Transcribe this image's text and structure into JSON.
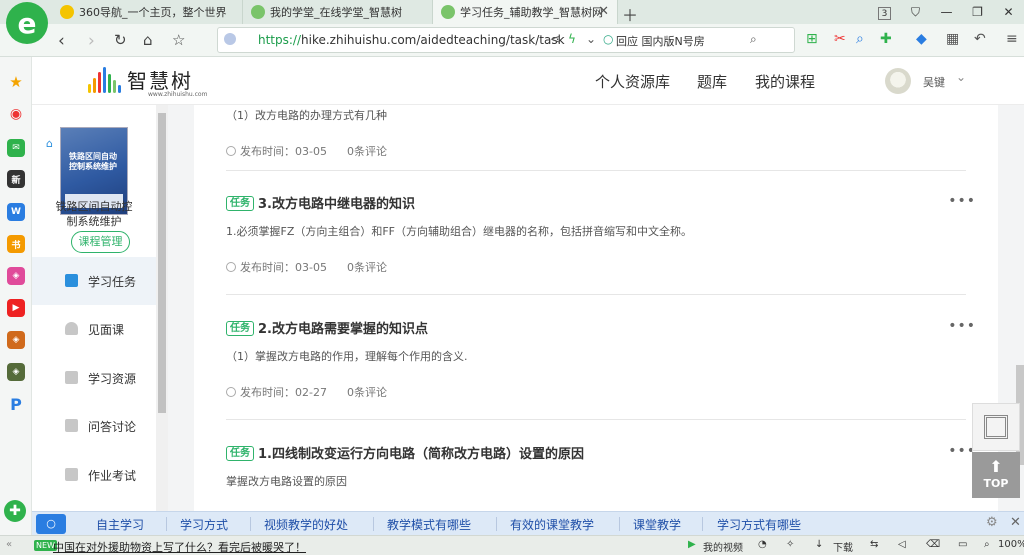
{
  "browser": {
    "tabs": [
      {
        "title": "360导航_一个主页，整个世界",
        "icon": "360-icon"
      },
      {
        "title": "我的学堂_在线学堂_智慧树",
        "icon": "zhihuishu-tab-icon"
      },
      {
        "title": "学习任务_辅助教学_智慧树网",
        "icon": "zhihuishu-tab-icon",
        "active": true
      }
    ],
    "tab_count": "3",
    "url_scheme": "https://",
    "url_rest": "hike.zhihuishu.com/aidedteaching/task/task",
    "search_hint": "回应 国内版N号房",
    "colors": {
      "brand": "#2fb24c",
      "accent": "#2fb36b"
    }
  },
  "site": {
    "logo_text": "智慧树",
    "logo_sub": "www.zhihuishu.com",
    "nav": [
      "个人资源库",
      "题库",
      "我的课程"
    ],
    "user_name": "吴键"
  },
  "sidebar": {
    "course_name": "铁路区间自动控制系统维护",
    "book_title": "铁路区间自动控制系统维护",
    "manage_label": "课程管理",
    "menu": [
      {
        "label": "学习任务",
        "icon": "task-icon",
        "active": true
      },
      {
        "label": "见面课",
        "icon": "person-icon"
      },
      {
        "label": "学习资源",
        "icon": "resource-icon"
      },
      {
        "label": "问答讨论",
        "icon": "qa-icon"
      },
      {
        "label": "作业考试",
        "icon": "exam-icon"
      }
    ]
  },
  "tasks": {
    "tag_label": "任务",
    "comment_suffix": "条评论",
    "published_prefix": "发布时间：",
    "partial_top": {
      "desc": "（1）改方电路的办理方式有几种",
      "date": "03-05",
      "comments": "0"
    },
    "items": [
      {
        "title": "3.改方电路中继电器的知识",
        "desc": "1.必须掌握FZ（方向主组合）和FF（方向辅助组合）继电器的名称，包括拼音缩写和中文全称。",
        "date": "03-05",
        "comments": "0"
      },
      {
        "title": "2.改方电路需要掌握的知识点",
        "desc": "（1）掌握改方电路的作用，理解每个作用的含义.",
        "date": "02-27",
        "comments": "0"
      },
      {
        "title": "1.四线制改变运行方向电路（简称改方电路）设置的原因",
        "desc": "掌握改方电路设置的原因",
        "date": "",
        "comments": ""
      }
    ]
  },
  "float": {
    "top_label": "TOP"
  },
  "hotbar": {
    "items": [
      "自主学习",
      "学习方式",
      "视频教学的好处",
      "教学模式有哪些",
      "有效的课堂教学",
      "课堂教学",
      "学习方式有哪些"
    ]
  },
  "status": {
    "new_badge": "NEW",
    "news": "中国在对外援助物资上写了什么？看完后被暖哭了！",
    "video": "我的视频",
    "download": "下载",
    "zoom": "100%"
  }
}
